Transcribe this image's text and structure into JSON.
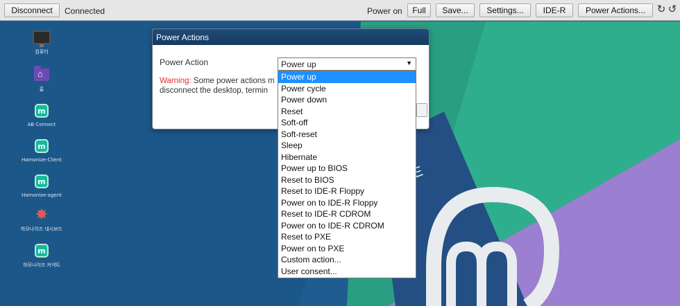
{
  "toolbar": {
    "disconnect": "Disconnect",
    "status": "Connected",
    "power_state": "Power on",
    "full": "Full",
    "save": "Save...",
    "settings": "Settings...",
    "ider": "IDE-R",
    "power_actions": "Power Actions...",
    "rotate_left_icon": "↻",
    "rotate_right_icon": "↺"
  },
  "desktop_icons": [
    {
      "name": "computer-icon",
      "label": "컴퓨터"
    },
    {
      "name": "home-folder-icon",
      "label": "홈"
    },
    {
      "name": "mint-app-icon",
      "label": "AB Connect"
    },
    {
      "name": "mint-app-icon",
      "label": "Hamonize-Client"
    },
    {
      "name": "mint-app-icon",
      "label": "Hamonize-agent"
    },
    {
      "name": "star-app-icon",
      "label": "하모나이즈 대시보드"
    },
    {
      "name": "mint-app-icon",
      "label": "하모나이즈 커넥트"
    }
  ],
  "dialog": {
    "title": "Power Actions",
    "label": "Power Action",
    "warning_key": "Warning:",
    "warning_line1": " Some power actions m",
    "warning_line2": "disconnect the desktop, termin",
    "selected": "Power up",
    "options": [
      "Power up",
      "Power cycle",
      "Power down",
      "Reset",
      "Soft-off",
      "Soft-reset",
      "Sleep",
      "Hibernate",
      "Power up to BIOS",
      "Reset to BIOS",
      "Reset to IDE-R Floppy",
      "Power on to IDE-R Floppy",
      "Reset to IDE-R CDROM",
      "Power on to IDE-R CDROM",
      "Reset to PXE",
      "Power on to PXE",
      "Custom action...",
      "User consent..."
    ],
    "highlighted_index": 0
  },
  "colors": {
    "wallpaper_blue": "#1f5c8f",
    "wallpaper_teal": "#2fae8e",
    "wallpaper_purple": "#9b7fd0",
    "title_bar": "#1a4470",
    "highlight": "#1e90ff",
    "warning": "#e03030"
  }
}
